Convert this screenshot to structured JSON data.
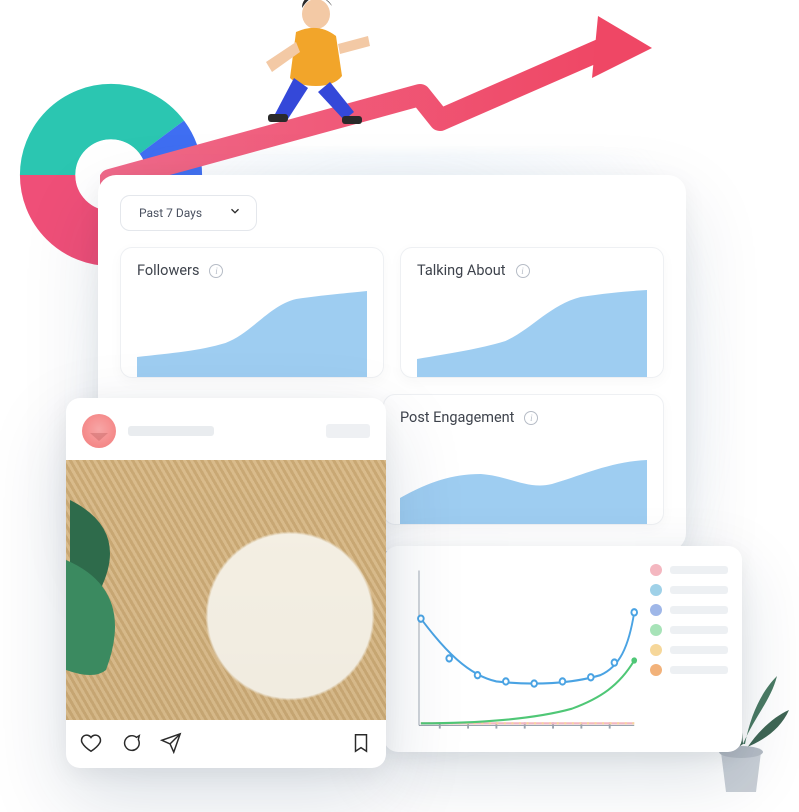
{
  "dashboard": {
    "date_range_label": "Past 7 Days",
    "cards": [
      {
        "title": "Followers"
      },
      {
        "title": "Talking About"
      },
      {
        "title": "Post Engagement"
      }
    ]
  },
  "line_chart": {
    "legend_colors": [
      "#f4b7c0",
      "#9fd1e8",
      "#9fb7e8",
      "#a7e3b8",
      "#f6d79a",
      "#f2b27a"
    ]
  },
  "chart_data": [
    {
      "type": "pie",
      "title": "",
      "series": [
        {
          "name": "teal",
          "value": 40,
          "color": "#2bc6b1"
        },
        {
          "name": "blue",
          "value": 33,
          "color": "#3f6ef2"
        },
        {
          "name": "pink",
          "value": 27,
          "color": "#ef4f78"
        }
      ]
    },
    {
      "type": "area",
      "title": "Followers",
      "x": [
        0,
        1,
        2,
        3,
        4,
        5,
        6,
        7,
        8,
        9
      ],
      "values": [
        20,
        22,
        24,
        26,
        34,
        60,
        72,
        76,
        80,
        82
      ],
      "ylim": [
        0,
        100
      ]
    },
    {
      "type": "area",
      "title": "Talking About",
      "x": [
        0,
        1,
        2,
        3,
        4,
        5,
        6,
        7,
        8,
        9
      ],
      "values": [
        18,
        22,
        24,
        28,
        38,
        60,
        74,
        80,
        84,
        86
      ],
      "ylim": [
        0,
        100
      ]
    },
    {
      "type": "area",
      "title": "Post Engagement",
      "x": [
        0,
        1,
        2,
        3,
        4,
        5,
        6,
        7,
        8,
        9
      ],
      "values": [
        28,
        44,
        52,
        52,
        46,
        38,
        44,
        58,
        64,
        64
      ],
      "ylim": [
        0,
        100
      ]
    },
    {
      "type": "line",
      "title": "",
      "x": [
        0,
        1,
        2,
        3,
        4,
        5,
        6,
        7,
        8
      ],
      "series": [
        {
          "name": "blue",
          "color": "#4aa3e3",
          "values": [
            62,
            40,
            32,
            30,
            30,
            30,
            30,
            34,
            58
          ]
        },
        {
          "name": "green",
          "color": "#4fc776",
          "values": [
            2,
            2,
            2,
            3,
            3,
            4,
            6,
            12,
            30
          ]
        },
        {
          "name": "pink",
          "color": "#f4b7c0",
          "values": [
            0,
            0,
            0,
            0,
            0,
            0,
            0,
            0,
            0
          ]
        },
        {
          "name": "yellow",
          "color": "#f6d79a",
          "values": [
            0,
            0,
            0,
            0,
            0,
            0,
            0,
            0,
            0
          ]
        },
        {
          "name": "orange",
          "color": "#f2b27a",
          "values": [
            0,
            0,
            0,
            0,
            0,
            0,
            0,
            0,
            0
          ]
        }
      ],
      "ylim": [
        0,
        100
      ]
    }
  ]
}
